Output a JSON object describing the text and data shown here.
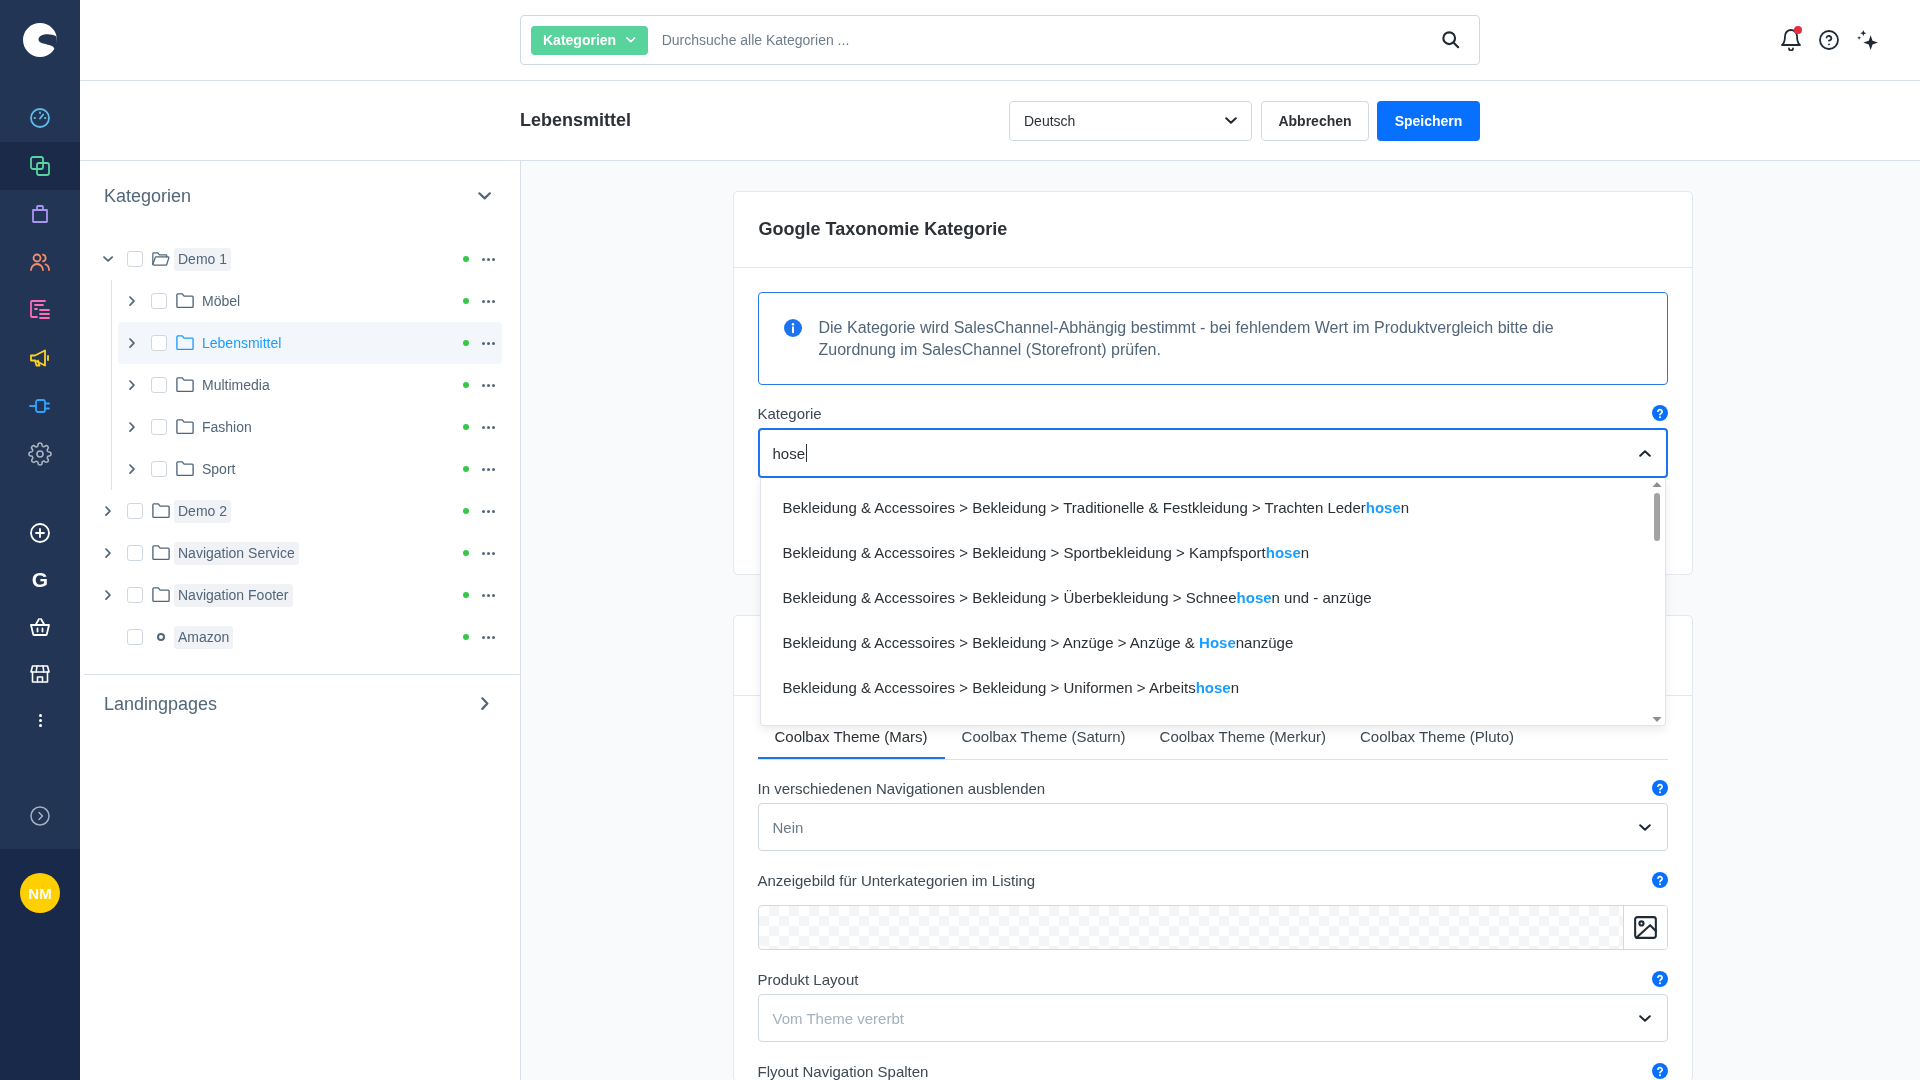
{
  "navigation": {
    "items": [
      {
        "kind": "dashboard",
        "selected": false
      },
      {
        "kind": "catalog",
        "selected": true
      },
      {
        "kind": "orders",
        "selected": false
      },
      {
        "kind": "customers",
        "selected": false
      },
      {
        "kind": "content",
        "selected": false
      },
      {
        "kind": "marketing",
        "selected": false
      },
      {
        "kind": "extensions",
        "selected": false
      },
      {
        "kind": "settings",
        "selected": false
      }
    ],
    "extra_items": [
      {
        "kind": "add",
        "selected": false
      },
      {
        "kind": "letter",
        "label": "G",
        "selected": false
      },
      {
        "kind": "basket",
        "selected": false
      },
      {
        "kind": "storefront",
        "selected": false
      },
      {
        "kind": "more",
        "selected": false
      }
    ],
    "user": {
      "initials": "NM"
    }
  },
  "search": {
    "scope": "Kategorien",
    "placeholder": "Durchsuche alle Kategorien ..."
  },
  "notifications": {
    "unread": true
  },
  "header": {
    "title": "Lebensmittel",
    "language": "Deutsch",
    "buttons": [
      {
        "label": "Abbrechen",
        "kind": "secondary"
      },
      {
        "label": "Speichern",
        "kind": "primary"
      }
    ]
  },
  "category_panel": {
    "title": "Kategorien",
    "expanded": true,
    "tree": [
      {
        "label": "Demo 1",
        "kind": "folder",
        "expanded": true,
        "checked": false,
        "selected": false,
        "active": true,
        "children": [
          {
            "label": "Möbel",
            "kind": "folder",
            "expanded": false,
            "checked": false,
            "selected": false,
            "active": true
          },
          {
            "label": "Lebensmittel",
            "kind": "folder",
            "expanded": false,
            "checked": false,
            "selected": true,
            "active": true
          },
          {
            "label": "Multimedia",
            "kind": "folder",
            "expanded": false,
            "checked": false,
            "selected": false,
            "active": true
          },
          {
            "label": "Fashion",
            "kind": "folder",
            "expanded": false,
            "checked": false,
            "selected": false,
            "active": true
          },
          {
            "label": "Sport",
            "kind": "folder",
            "expanded": false,
            "checked": false,
            "selected": false,
            "active": true
          }
        ]
      },
      {
        "label": "Demo 2",
        "kind": "folder",
        "expanded": false,
        "checked": false,
        "selected": false,
        "active": true
      },
      {
        "label": "Navigation Service",
        "kind": "folder",
        "expanded": false,
        "checked": false,
        "selected": false,
        "active": true
      },
      {
        "label": "Navigation Footer",
        "kind": "folder",
        "expanded": false,
        "checked": false,
        "selected": false,
        "active": true
      },
      {
        "label": "Amazon",
        "kind": "link",
        "checked": false,
        "selected": false,
        "active": true
      }
    ]
  },
  "landingpages": {
    "title": "Landingpages",
    "expanded": false
  },
  "taxonomy_card": {
    "title": "Google Taxonomie Kategorie",
    "info": "Die Kategorie wird SalesChannel-Abhängig bestimmt - bei fehlendem Wert im Produktvergleich bitte die Zuordnung im SalesChannel (Storefront) prüfen.",
    "field": {
      "label": "Kategorie",
      "value": "hose",
      "open": true,
      "options": [
        "Bekleidung & Accessoires > Bekleidung > Traditionelle & Festkleidung > Trachten Leder**hose**n",
        "Bekleidung & Accessoires > Bekleidung > Sportbekleidung > Kampfsport**hose**n",
        "Bekleidung & Accessoires > Bekleidung > Überbekleidung > Schnee**hose**n und - anzüge",
        "Bekleidung & Accessoires > Bekleidung > Anzüge > Anzüge & **Hose**nanzüge",
        "Bekleidung & Accessoires > Bekleidung > Uniformen > Arbeits**hose**n"
      ]
    }
  },
  "theme_card": {
    "tabs": [
      {
        "label": "Coolbax Theme (Mars)",
        "selected": true
      },
      {
        "label": "Coolbax Theme (Saturn)",
        "selected": false
      },
      {
        "label": "Coolbax Theme (Merkur)",
        "selected": false
      },
      {
        "label": "Coolbax Theme (Pluto)",
        "selected": false
      }
    ],
    "fields": [
      {
        "kind": "select",
        "label": "In verschiedenen Navigationen ausblenden",
        "value": "Nein"
      },
      {
        "kind": "image",
        "label": "Anzeigebild für Unterkategorien im Listing"
      },
      {
        "kind": "select",
        "label": "Produkt Layout",
        "placeholder": "Vom Theme vererbt"
      },
      {
        "kind": "label",
        "label": "Flyout Navigation Spalten"
      }
    ]
  }
}
